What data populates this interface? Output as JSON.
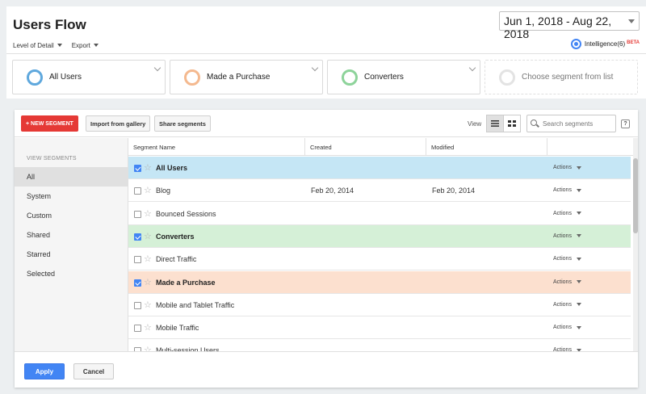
{
  "header": {
    "title": "Users Flow",
    "date_range": "Jun 1, 2018 - Aug 22, 2018",
    "toolbar": {
      "level_of_detail": "Level of Detail",
      "export": "Export"
    },
    "intelligence": {
      "label": "Intelligence(6)",
      "badge": "BETA"
    }
  },
  "segment_bar": {
    "cards": [
      {
        "label": "All Users",
        "color": "#5fa8dd"
      },
      {
        "label": "Made a Purchase",
        "color": "#f4b98f"
      },
      {
        "label": "Converters",
        "color": "#8dd39a"
      }
    ],
    "placeholder": "Choose segment from list"
  },
  "panel": {
    "buttons": {
      "new_segment": "+ NEW SEGMENT",
      "import": "Import from gallery",
      "share": "Share segments"
    },
    "view_label": "View",
    "search_placeholder": "Search segments",
    "help": "?",
    "sidebar": {
      "caption": "VIEW SEGMENTS",
      "items": [
        "All",
        "System",
        "Custom",
        "Shared",
        "Starred",
        "Selected"
      ]
    },
    "table": {
      "columns": [
        "Segment Name",
        "Created",
        "Modified"
      ],
      "actions_label": "Actions",
      "rows": [
        {
          "name": "All Users",
          "created": "",
          "modified": "",
          "checked": true,
          "bg": "#c5e6f5"
        },
        {
          "name": "Blog",
          "created": "Feb 20, 2014",
          "modified": "Feb 20, 2014",
          "checked": false,
          "bg": "#ffffff"
        },
        {
          "name": "Bounced Sessions",
          "created": "",
          "modified": "",
          "checked": false,
          "bg": "#ffffff"
        },
        {
          "name": "Converters",
          "created": "",
          "modified": "",
          "checked": true,
          "bg": "#d5f0d7"
        },
        {
          "name": "Direct Traffic",
          "created": "",
          "modified": "",
          "checked": false,
          "bg": "#ffffff"
        },
        {
          "name": "Made a Purchase",
          "created": "",
          "modified": "",
          "checked": true,
          "bg": "#fce0cf"
        },
        {
          "name": "Mobile and Tablet Traffic",
          "created": "",
          "modified": "",
          "checked": false,
          "bg": "#ffffff"
        },
        {
          "name": "Mobile Traffic",
          "created": "",
          "modified": "",
          "checked": false,
          "bg": "#ffffff"
        },
        {
          "name": "Multi-session Users",
          "created": "",
          "modified": "",
          "checked": false,
          "bg": "#ffffff"
        }
      ]
    },
    "footer": {
      "apply": "Apply",
      "cancel": "Cancel"
    }
  }
}
